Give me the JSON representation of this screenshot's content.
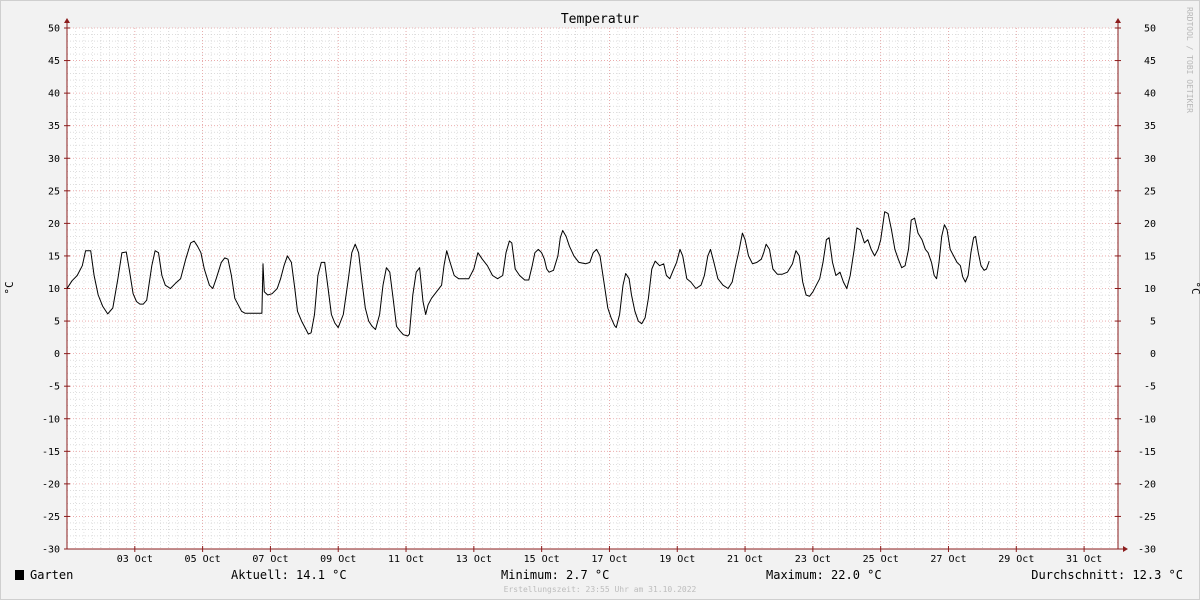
{
  "chart_data": {
    "type": "line",
    "title": "Temperatur",
    "ylabel_left": "°C",
    "ylabel_right": "°C",
    "ylim": [
      -30,
      50
    ],
    "y_ticks": [
      50,
      45,
      40,
      35,
      30,
      25,
      20,
      15,
      10,
      5,
      0,
      -5,
      -10,
      -15,
      -20,
      -25,
      -30
    ],
    "xlim_days": [
      1,
      32
    ],
    "x_tick_labels": [
      "03 Oct",
      "05 Oct",
      "07 Oct",
      "09 Oct",
      "11 Oct",
      "13 Oct",
      "15 Oct",
      "17 Oct",
      "19 Oct",
      "21 Oct",
      "23 Oct",
      "25 Oct",
      "27 Oct",
      "29 Oct",
      "31 Oct"
    ],
    "x_tick_days": [
      3,
      5,
      7,
      9,
      11,
      13,
      15,
      17,
      19,
      21,
      23,
      25,
      27,
      29,
      31
    ],
    "grid": true,
    "series": [
      {
        "name": "Garten",
        "color": "#000000",
        "points": [
          [
            1.0,
            10.0
          ],
          [
            1.15,
            11.2
          ],
          [
            1.3,
            12.0
          ],
          [
            1.45,
            13.5
          ],
          [
            1.55,
            15.8
          ],
          [
            1.7,
            15.8
          ],
          [
            1.8,
            12.0
          ],
          [
            1.92,
            9.0
          ],
          [
            2.05,
            7.3
          ],
          [
            2.2,
            6.1
          ],
          [
            2.35,
            7.0
          ],
          [
            2.5,
            11.5
          ],
          [
            2.62,
            15.5
          ],
          [
            2.75,
            15.6
          ],
          [
            2.85,
            12.5
          ],
          [
            2.95,
            9.2
          ],
          [
            3.05,
            8.0
          ],
          [
            3.15,
            7.6
          ],
          [
            3.25,
            7.6
          ],
          [
            3.35,
            8.2
          ],
          [
            3.5,
            13.5
          ],
          [
            3.6,
            15.8
          ],
          [
            3.7,
            15.5
          ],
          [
            3.8,
            12.0
          ],
          [
            3.9,
            10.5
          ],
          [
            4.05,
            10.0
          ],
          [
            4.2,
            10.8
          ],
          [
            4.35,
            11.5
          ],
          [
            4.5,
            14.5
          ],
          [
            4.65,
            17.0
          ],
          [
            4.75,
            17.3
          ],
          [
            4.85,
            16.5
          ],
          [
            4.95,
            15.5
          ],
          [
            5.05,
            13.0
          ],
          [
            5.2,
            10.5
          ],
          [
            5.3,
            10.0
          ],
          [
            5.4,
            11.5
          ],
          [
            5.55,
            14.0
          ],
          [
            5.65,
            14.7
          ],
          [
            5.75,
            14.5
          ],
          [
            5.85,
            12.0
          ],
          [
            5.95,
            8.5
          ],
          [
            6.05,
            7.5
          ],
          [
            6.15,
            6.5
          ],
          [
            6.25,
            6.2
          ],
          [
            6.4,
            6.2
          ],
          [
            6.55,
            6.2
          ],
          [
            6.7,
            6.2
          ],
          [
            6.75,
            6.2
          ],
          [
            6.78,
            13.8
          ],
          [
            6.82,
            9.5
          ],
          [
            6.92,
            9.0
          ],
          [
            7.05,
            9.2
          ],
          [
            7.2,
            10.0
          ],
          [
            7.3,
            11.5
          ],
          [
            7.4,
            13.5
          ],
          [
            7.5,
            15.0
          ],
          [
            7.62,
            14.0
          ],
          [
            7.72,
            10.0
          ],
          [
            7.8,
            6.5
          ],
          [
            7.92,
            5.0
          ],
          [
            8.05,
            3.7
          ],
          [
            8.12,
            3.0
          ],
          [
            8.2,
            3.2
          ],
          [
            8.3,
            6.0
          ],
          [
            8.4,
            12.0
          ],
          [
            8.5,
            14.0
          ],
          [
            8.6,
            14.0
          ],
          [
            8.7,
            10.0
          ],
          [
            8.8,
            6.0
          ],
          [
            8.9,
            4.7
          ],
          [
            9.0,
            4.0
          ],
          [
            9.15,
            6.0
          ],
          [
            9.3,
            11.5
          ],
          [
            9.4,
            15.5
          ],
          [
            9.5,
            16.8
          ],
          [
            9.6,
            15.5
          ],
          [
            9.7,
            11.0
          ],
          [
            9.8,
            7.0
          ],
          [
            9.9,
            5.0
          ],
          [
            10.0,
            4.2
          ],
          [
            10.1,
            3.7
          ],
          [
            10.22,
            6.0
          ],
          [
            10.32,
            10.5
          ],
          [
            10.42,
            13.2
          ],
          [
            10.52,
            12.5
          ],
          [
            10.62,
            8.5
          ],
          [
            10.72,
            4.2
          ],
          [
            10.82,
            3.5
          ],
          [
            10.92,
            2.9
          ],
          [
            11.05,
            2.7
          ],
          [
            11.1,
            3.0
          ],
          [
            11.2,
            9.0
          ],
          [
            11.3,
            12.5
          ],
          [
            11.4,
            13.2
          ],
          [
            11.5,
            8.0
          ],
          [
            11.58,
            6.0
          ],
          [
            11.65,
            7.5
          ],
          [
            11.75,
            8.5
          ],
          [
            11.9,
            9.5
          ],
          [
            12.05,
            10.5
          ],
          [
            12.12,
            13.5
          ],
          [
            12.2,
            15.8
          ],
          [
            12.3,
            14.0
          ],
          [
            12.42,
            12.0
          ],
          [
            12.55,
            11.5
          ],
          [
            12.7,
            11.5
          ],
          [
            12.85,
            11.5
          ],
          [
            13.0,
            13.0
          ],
          [
            13.12,
            15.5
          ],
          [
            13.25,
            14.5
          ],
          [
            13.4,
            13.5
          ],
          [
            13.55,
            12.0
          ],
          [
            13.7,
            11.5
          ],
          [
            13.85,
            12.0
          ],
          [
            13.95,
            15.5
          ],
          [
            14.05,
            17.3
          ],
          [
            14.12,
            17.0
          ],
          [
            14.22,
            13.0
          ],
          [
            14.35,
            12.0
          ],
          [
            14.5,
            11.3
          ],
          [
            14.62,
            11.3
          ],
          [
            14.72,
            13.5
          ],
          [
            14.8,
            15.5
          ],
          [
            14.9,
            16.0
          ],
          [
            15.0,
            15.5
          ],
          [
            15.08,
            14.5
          ],
          [
            15.15,
            13.0
          ],
          [
            15.22,
            12.5
          ],
          [
            15.35,
            12.8
          ],
          [
            15.48,
            15.0
          ],
          [
            15.55,
            17.8
          ],
          [
            15.62,
            18.9
          ],
          [
            15.72,
            18.0
          ],
          [
            15.82,
            16.5
          ],
          [
            15.95,
            15.0
          ],
          [
            16.1,
            14.0
          ],
          [
            16.3,
            13.8
          ],
          [
            16.42,
            14.0
          ],
          [
            16.52,
            15.5
          ],
          [
            16.62,
            16.0
          ],
          [
            16.72,
            15.0
          ],
          [
            16.85,
            10.5
          ],
          [
            16.95,
            7.0
          ],
          [
            17.05,
            5.5
          ],
          [
            17.15,
            4.3
          ],
          [
            17.2,
            4.0
          ],
          [
            17.3,
            6.0
          ],
          [
            17.4,
            10.5
          ],
          [
            17.48,
            12.3
          ],
          [
            17.58,
            11.5
          ],
          [
            17.65,
            9.0
          ],
          [
            17.75,
            6.5
          ],
          [
            17.85,
            5.0
          ],
          [
            17.95,
            4.6
          ],
          [
            18.05,
            5.5
          ],
          [
            18.15,
            8.5
          ],
          [
            18.25,
            13.0
          ],
          [
            18.35,
            14.2
          ],
          [
            18.48,
            13.5
          ],
          [
            18.6,
            13.8
          ],
          [
            18.68,
            12.0
          ],
          [
            18.78,
            11.5
          ],
          [
            18.88,
            12.8
          ],
          [
            18.98,
            14.0
          ],
          [
            19.08,
            16.0
          ],
          [
            19.16,
            15.0
          ],
          [
            19.28,
            11.5
          ],
          [
            19.4,
            11.0
          ],
          [
            19.55,
            10.0
          ],
          [
            19.7,
            10.5
          ],
          [
            19.8,
            12.0
          ],
          [
            19.9,
            15.0
          ],
          [
            19.98,
            16.0
          ],
          [
            20.08,
            14.0
          ],
          [
            20.2,
            11.5
          ],
          [
            20.35,
            10.5
          ],
          [
            20.5,
            10.0
          ],
          [
            20.62,
            11.0
          ],
          [
            20.72,
            13.5
          ],
          [
            20.82,
            15.8
          ],
          [
            20.92,
            18.5
          ],
          [
            21.0,
            17.5
          ],
          [
            21.1,
            15.0
          ],
          [
            21.22,
            13.8
          ],
          [
            21.35,
            14.0
          ],
          [
            21.48,
            14.5
          ],
          [
            21.55,
            15.5
          ],
          [
            21.62,
            16.8
          ],
          [
            21.72,
            16.0
          ],
          [
            21.82,
            13.0
          ],
          [
            21.95,
            12.2
          ],
          [
            22.1,
            12.2
          ],
          [
            22.25,
            12.5
          ],
          [
            22.4,
            13.8
          ],
          [
            22.5,
            15.8
          ],
          [
            22.6,
            15.0
          ],
          [
            22.7,
            11.0
          ],
          [
            22.8,
            9.0
          ],
          [
            22.9,
            8.8
          ],
          [
            23.0,
            9.5
          ],
          [
            23.1,
            10.5
          ],
          [
            23.2,
            11.5
          ],
          [
            23.3,
            14.0
          ],
          [
            23.4,
            17.5
          ],
          [
            23.48,
            17.8
          ],
          [
            23.58,
            14.0
          ],
          [
            23.68,
            12.0
          ],
          [
            23.8,
            12.5
          ],
          [
            23.9,
            11.0
          ],
          [
            24.0,
            10.0
          ],
          [
            24.1,
            12.0
          ],
          [
            24.22,
            16.0
          ],
          [
            24.3,
            19.3
          ],
          [
            24.4,
            19.0
          ],
          [
            24.52,
            17.0
          ],
          [
            24.62,
            17.5
          ],
          [
            24.72,
            16.0
          ],
          [
            24.82,
            15.0
          ],
          [
            24.92,
            16.0
          ],
          [
            25.0,
            17.5
          ],
          [
            25.12,
            21.8
          ],
          [
            25.22,
            21.5
          ],
          [
            25.32,
            19.0
          ],
          [
            25.42,
            16.0
          ],
          [
            25.52,
            14.5
          ],
          [
            25.62,
            13.2
          ],
          [
            25.72,
            13.5
          ],
          [
            25.82,
            16.0
          ],
          [
            25.9,
            20.5
          ],
          [
            26.0,
            20.8
          ],
          [
            26.1,
            18.5
          ],
          [
            26.22,
            17.5
          ],
          [
            26.32,
            16.0
          ],
          [
            26.4,
            15.5
          ],
          [
            26.5,
            14.0
          ],
          [
            26.58,
            12.0
          ],
          [
            26.65,
            11.5
          ],
          [
            26.72,
            14.0
          ],
          [
            26.8,
            18.0
          ],
          [
            26.88,
            19.8
          ],
          [
            26.96,
            19.0
          ],
          [
            27.05,
            16.0
          ],
          [
            27.15,
            15.0
          ],
          [
            27.25,
            14.0
          ],
          [
            27.35,
            13.5
          ],
          [
            27.42,
            11.8
          ],
          [
            27.5,
            11.0
          ],
          [
            27.58,
            12.0
          ],
          [
            27.66,
            15.5
          ],
          [
            27.74,
            17.8
          ],
          [
            27.8,
            18.0
          ],
          [
            27.88,
            15.5
          ],
          [
            27.96,
            13.5
          ],
          [
            28.05,
            12.8
          ],
          [
            28.12,
            13.0
          ],
          [
            28.2,
            14.2
          ]
        ]
      }
    ]
  },
  "legend": {
    "series_name": "Garten",
    "swatch_color": "#000000"
  },
  "stats": {
    "current": "Aktuell: 14.1 °C",
    "minimum": "Minimum: 2.7 °C",
    "maximum": "Maximum: 22.0 °C",
    "average": "Durchschnitt: 12.3 °C"
  },
  "footer": "Erstellungszeit: 23:55 Uhr am 31.10.2022",
  "watermark": "RRDTOOL / TOBI OETIKER",
  "colors": {
    "background": "#f2f2f2",
    "plot_background": "#ffffff",
    "minor_grid": "#c9c9c9",
    "major_grid": "#e8a0a0",
    "axis": "#8b1c1c",
    "line": "#000000"
  }
}
